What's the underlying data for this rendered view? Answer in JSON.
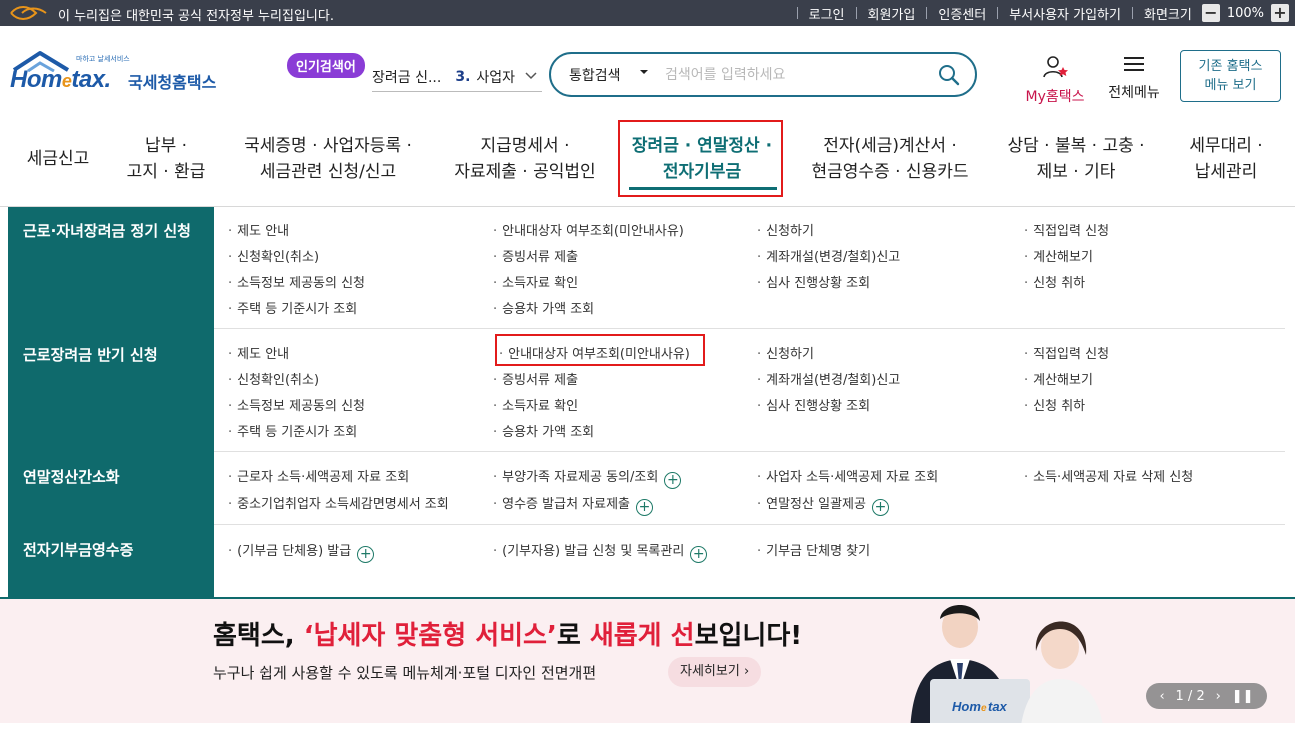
{
  "govbar": {
    "notice": "이 누리집은 대한민국 공식 전자정부 누리집입니다.",
    "links": [
      "로그인",
      "회원가입",
      "인증센터",
      "부서사용자 가입하기"
    ],
    "screen_size_label": "화면크기",
    "zoom_minus": "−",
    "zoom_value": "100%",
    "zoom_plus": "+"
  },
  "logo": {
    "tagline": "마하고 날세서비스",
    "brand": "Hom",
    "brand_e": "e",
    "brand_tail": "tax.",
    "name": "국세청홈택스"
  },
  "popular": {
    "badge": "인기검색어",
    "prev_text": "장려금 신...",
    "rank": "3.",
    "keyword": "사업자"
  },
  "search": {
    "scope": "통합검색",
    "placeholder": "검색어를 입력하세요"
  },
  "header": {
    "my_hometax": "My홈택스",
    "all_menu": "전체메뉴",
    "old_view_line1": "기존 홈택스",
    "old_view_line2": "메뉴 보기"
  },
  "gnb": [
    {
      "l1": "세금신고",
      "l2": ""
    },
    {
      "l1": "납부 ·",
      "l2": "고지 · 환급"
    },
    {
      "l1": "국세증명 · 사업자등록 ·",
      "l2": "세금관련 신청/신고"
    },
    {
      "l1": "지급명세서 ·",
      "l2": "자료제출 · 공익법인"
    },
    {
      "l1": "장려금 · 연말정산 ·",
      "l2": "전자기부금"
    },
    {
      "l1": "전자(세금)계산서 ·",
      "l2": "현금영수증 · 신용카드"
    },
    {
      "l1": "상담 · 불복 · 고충 ·",
      "l2": "제보 · 기타"
    },
    {
      "l1": "세무대리 ·",
      "l2": "납세관리"
    }
  ],
  "mega": [
    {
      "head": "근로·자녀장려금 정기 신청",
      "items": [
        "제도 안내",
        "안내대상자 여부조회(미안내사유)",
        "신청하기",
        "직접입력 신청",
        "신청확인(취소)",
        "증빙서류 제출",
        "계좌개설(변경/철회)신고",
        "계산해보기",
        "소득정보 제공동의 신청",
        "소득자료 확인",
        "심사 진행상황 조회",
        "신청 취하",
        "주택 등 기준시가 조회",
        "승용차 가액 조회"
      ]
    },
    {
      "head": "근로장려금 반기 신청",
      "items": [
        "제도 안내",
        "안내대상자 여부조회(미안내사유)",
        "신청하기",
        "직접입력 신청",
        "신청확인(취소)",
        "증빙서류 제출",
        "계좌개설(변경/철회)신고",
        "계산해보기",
        "소득정보 제공동의 신청",
        "소득자료 확인",
        "심사 진행상황 조회",
        "신청 취하",
        "주택 등 기준시가 조회",
        "승용차 가액 조회"
      ]
    },
    {
      "head": "연말정산간소화",
      "items": [
        "근로자 소득·세액공제 자료 조회",
        "부양가족 자료제공 동의/조회",
        "사업자 소득·세액공제 자료 조회",
        "소득·세액공제 자료 삭제 신청",
        "중소기업취업자 소득세감면명세서 조회",
        "영수증 발급처 자료제출",
        "연말정산 일괄제공"
      ]
    },
    {
      "head": "전자기부금영수증",
      "items": [
        "(기부금 단체용) 발급",
        "(기부자용) 발급 신청 및 목록관리",
        "기부금 단체명 찾기"
      ]
    }
  ],
  "banner": {
    "title_a": "홈택스, ",
    "title_red1": "‘납세자 맞춤형 서비스’",
    "title_b": "로 ",
    "title_red2": "새롭게 선",
    "title_c": "보입니다!",
    "subtitle": "누구나 쉽게 사용할 수 있도록 메뉴체계·포털 디자인 전면개편",
    "more": "자세히보기",
    "pager": "1 / 2"
  },
  "colors": {
    "teal": "#0f6a6c",
    "highlight_red": "#e21b1b",
    "badge_purple": "#8a3cd6",
    "banner_red": "#e0203a"
  }
}
